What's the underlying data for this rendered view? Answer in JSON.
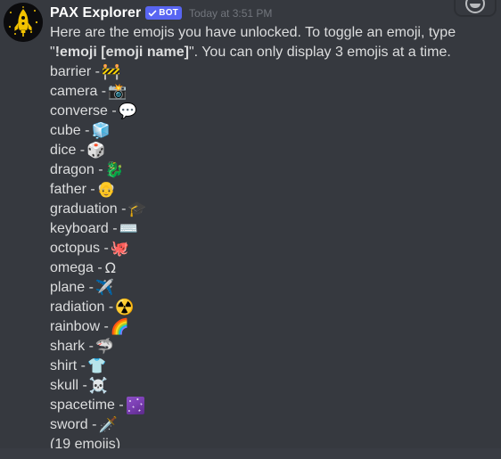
{
  "message": {
    "avatar_icon": "rocket-avatar",
    "username": "PAX Explorer",
    "bot_badge": "BOT",
    "timestamp": "Today at 3:51 PM",
    "intro_part1": "Here are the emojis you have unlocked. To toggle an emoji, type \"",
    "intro_bold": "!emoji [emoji name]",
    "intro_part2": "\". You can only display 3 emojis at a time.",
    "separator": " - ",
    "footer": "(19 emojis)"
  },
  "hover_toolbar": {
    "add_reaction_icon": "add-reaction-icon"
  },
  "emojis": [
    {
      "name": "barrier",
      "glyph": "🚧",
      "kind": "unicode"
    },
    {
      "name": "camera",
      "glyph": "📸",
      "kind": "unicode"
    },
    {
      "name": "converse",
      "glyph": "💬",
      "kind": "unicode"
    },
    {
      "name": "cube",
      "glyph": "🧊",
      "kind": "unicode"
    },
    {
      "name": "dice",
      "glyph": "🎲",
      "kind": "unicode"
    },
    {
      "name": "dragon",
      "glyph": "🐉",
      "kind": "unicode"
    },
    {
      "name": "father",
      "glyph": "👴",
      "kind": "unicode"
    },
    {
      "name": "graduation",
      "glyph": "🎓",
      "kind": "unicode"
    },
    {
      "name": "keyboard",
      "glyph": "⌨️",
      "kind": "unicode"
    },
    {
      "name": "octopus",
      "glyph": "🐙",
      "kind": "unicode"
    },
    {
      "name": "omega",
      "glyph": "Ω",
      "kind": "text"
    },
    {
      "name": "plane",
      "glyph": "✈️",
      "kind": "unicode"
    },
    {
      "name": "radiation",
      "glyph": "☢️",
      "kind": "unicode"
    },
    {
      "name": "rainbow",
      "glyph": "🌈",
      "kind": "unicode"
    },
    {
      "name": "shark",
      "glyph": "🦈",
      "kind": "unicode"
    },
    {
      "name": "shirt",
      "glyph": "👕",
      "kind": "unicode"
    },
    {
      "name": "skull",
      "glyph": "☠️",
      "kind": "unicode"
    },
    {
      "name": "spacetime",
      "glyph": "",
      "kind": "custom"
    },
    {
      "name": "sword",
      "glyph": "🗡️",
      "kind": "unicode"
    }
  ],
  "colors": {
    "background": "#36393f",
    "text": "#dcddde",
    "username": "#ffffff",
    "timestamp": "#72767d",
    "bot_badge": "#5865f2",
    "custom_emoji": "#7c3fb4"
  }
}
